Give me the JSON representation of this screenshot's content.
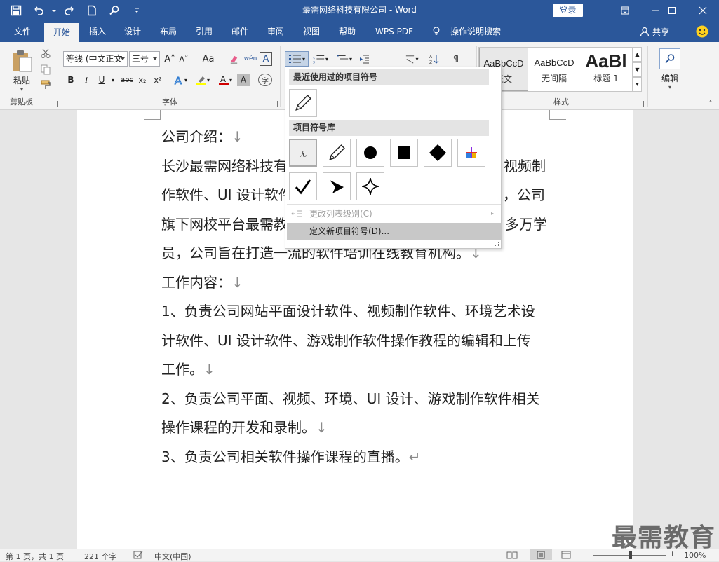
{
  "titlebar": {
    "title": "最需网络科技有限公司  -  Word",
    "login_label": "登录"
  },
  "tabs": [
    {
      "label": "文件"
    },
    {
      "label": "开始"
    },
    {
      "label": "插入"
    },
    {
      "label": "设计"
    },
    {
      "label": "布局"
    },
    {
      "label": "引用"
    },
    {
      "label": "邮件"
    },
    {
      "label": "审阅"
    },
    {
      "label": "视图"
    },
    {
      "label": "帮助"
    },
    {
      "label": "WPS PDF"
    },
    {
      "label": "操作说明搜索"
    }
  ],
  "share_label": "共享",
  "ribbon": {
    "clipboard": {
      "paste_label": "粘贴",
      "group_label": "剪贴板"
    },
    "font": {
      "font_name": "等线 (中文正文",
      "font_size": "三号",
      "group_label": "字体",
      "buttons": {
        "grow": "A˄",
        "shrink": "A˅",
        "case": "Aa",
        "bold": "B",
        "italic": "I",
        "underline": "U",
        "strike": "abc",
        "sub": "x₂",
        "sup": "x²",
        "phonetic": "wén",
        "border_char": "A",
        "char_shade": "A",
        "circle": "字"
      }
    },
    "styles": {
      "group_label": "样式",
      "items": [
        {
          "preview": "AaBbCcD",
          "name": "正文"
        },
        {
          "preview": "AaBbCcD",
          "name": "无间隔"
        },
        {
          "preview": "AaBl",
          "name": "标题 1"
        }
      ]
    },
    "editing": {
      "label": "编辑"
    }
  },
  "bullet_dropdown": {
    "recent_header": "最近使用过的项目符号",
    "library_header": "项目符号库",
    "none_label": "无",
    "change_level": "更改列表级别(C)",
    "define_new": "定义新项目符号(D)..."
  },
  "document": {
    "lines": [
      {
        "text": "公司介绍：",
        "mark": "↓"
      },
      {
        "text": "长沙最需网络科技有",
        "tail": "视频制"
      },
      {
        "text": "作软件、UI 设计软件",
        "tail": "司，公司"
      },
      {
        "text": "旗下网校平台最需教",
        "tail": "多万学"
      },
      {
        "text": "员，公司旨在打造一流的软件培训在线教育机构。",
        "mark": "↓"
      },
      {
        "text": "工作内容：",
        "mark": "↓"
      },
      {
        "text": "1、负责公司网站平面设计软件、视频制作软件、环境艺术设"
      },
      {
        "text": "计软件、UI 设计软件、游戏制作软件操作教程的编辑和上传"
      },
      {
        "text": "工作。",
        "mark": "↓"
      },
      {
        "text": "2、负责公司平面、视频、环境、UI 设计、游戏制作软件相关"
      },
      {
        "text": "操作课程的开发和录制。",
        "mark": "↓"
      },
      {
        "text": "3、负责公司相关软件操作课程的直播。",
        "mark": "↵"
      }
    ]
  },
  "statusbar": {
    "page": "第 1 页，共 1 页",
    "words": "221 个字",
    "language": "中文(中国)",
    "zoom": "100%"
  },
  "watermark": "最需教育",
  "colors": {
    "accent": "#2b579a",
    "ribbon_bg": "#f3f3f3",
    "highlight": "#ffff00",
    "font_red": "#d00000"
  }
}
